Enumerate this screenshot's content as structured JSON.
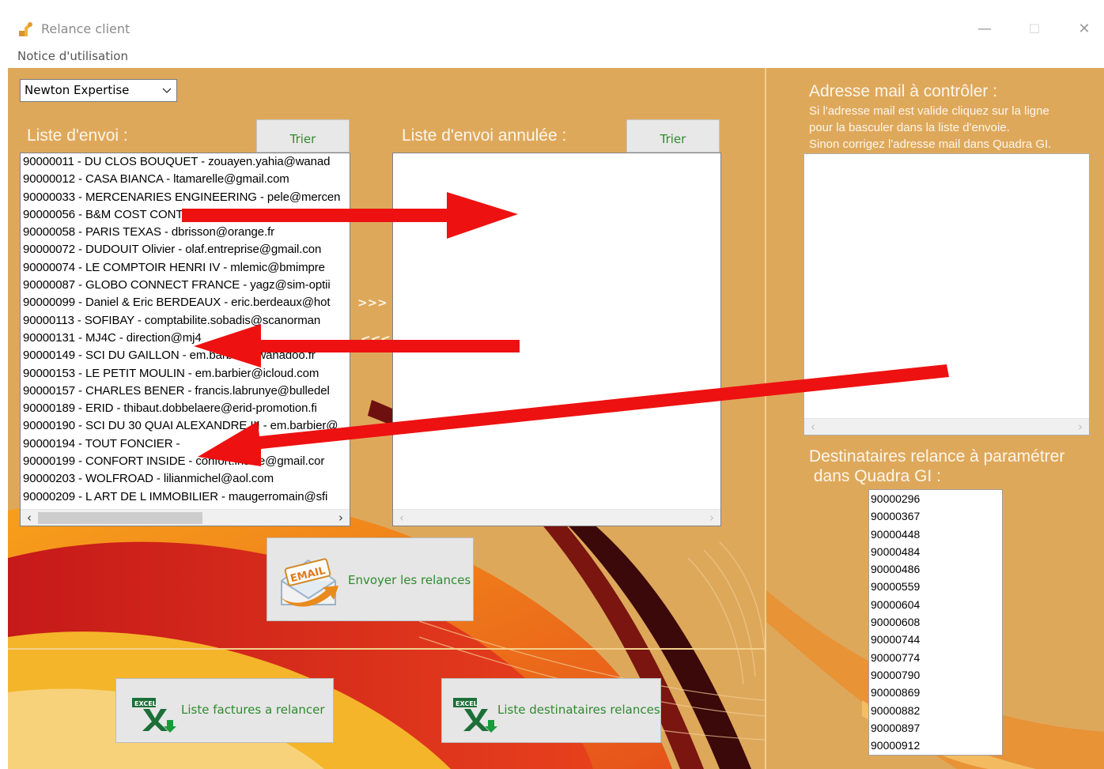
{
  "window": {
    "title": "Relance client",
    "controls": {
      "minimize": "—",
      "maximize": "☐",
      "close": "✕"
    }
  },
  "menu": {
    "help_label": "Notice d'utilisation"
  },
  "company_select": {
    "selected": "Newton Expertise"
  },
  "send_list": {
    "title": "Liste d'envoi :",
    "sort_label": "Trier",
    "items": [
      "90000011 - DU CLOS BOUQUET - zouayen.yahia@wanad",
      "90000012 - CASA BIANCA - ltamarelle@gmail.com",
      "90000033 - MERCENARIES ENGINEERING - pele@mercen",
      "90000056 - B&M COST CONTROLLERS - ",
      "90000058 - PARIS TEXAS - dbrisson@orange.fr",
      "90000072 - DUDOUIT Olivier - olaf.entreprise@gmail.con",
      "90000074 - LE COMPTOIR HENRI IV - mlemic@bmimpre",
      "90000087 - GLOBO CONNECT FRANCE - yagz@sim-optii",
      "90000099 - Daniel & Eric BERDEAUX - eric.berdeaux@hot",
      "90000113 - SOFIBAY - comptabilite.sobadis@scanorman",
      "90000131 - MJ4C - direction@mj4",
      "90000149 - SCI DU GAILLON - em.barbier@wanadoo.fr",
      "90000153 - LE PETIT MOULIN - em.barbier@icloud.com",
      "90000157 - CHARLES BENER - francis.labrunye@bulledel",
      "90000189 - ERID - thibaut.dobbelaere@erid-promotion.fi",
      "90000190 - SCI DU 30 QUAI ALEXANDRE III - em.barbier@",
      "90000194 - TOUT FONCIER - ",
      "90000199 - CONFORT INSIDE - confort.inside@gmail.cor",
      "90000203 - WOLFROAD - lilianmichel@aol.com",
      "90000209 - L ART DE L IMMOBILIER - maugerromain@sfi"
    ]
  },
  "movers": {
    "forward": ">>>",
    "back": "<<<"
  },
  "cancel_list": {
    "title": "Liste d'envoi annulée :",
    "sort_label": "Trier",
    "items": []
  },
  "check_panel": {
    "title": "Adresse mail à contrôler :",
    "line1": "Si l'adresse mail est valide cliquez sur la ligne",
    "line2": " pour la basculer dans la liste d'envoie.",
    "line3": " Sinon corrigez l'adresse mail dans Quadra GI."
  },
  "recipients_panel": {
    "title_line1": "Destinataires relance à paramétrer",
    "title_line2": " dans Quadra GI :",
    "items": [
      "90000296",
      "90000367",
      "90000448",
      "90000484",
      "90000486",
      "90000559",
      "90000604",
      "90000608",
      "90000744",
      "90000774",
      "90000790",
      "90000869",
      "90000882",
      "90000897",
      "90000912"
    ]
  },
  "actions": {
    "send_label": "Envoyer les relances",
    "email_icon_text": "EMAIL",
    "invoices_label": "Liste factures a relancer",
    "recipients_label": "Liste destinataires relances",
    "excel_icon_text": "EXCEL"
  },
  "colors": {
    "background": "#dea85b",
    "accent_green": "#2f8a2f",
    "annotation_red": "#ee1111"
  }
}
